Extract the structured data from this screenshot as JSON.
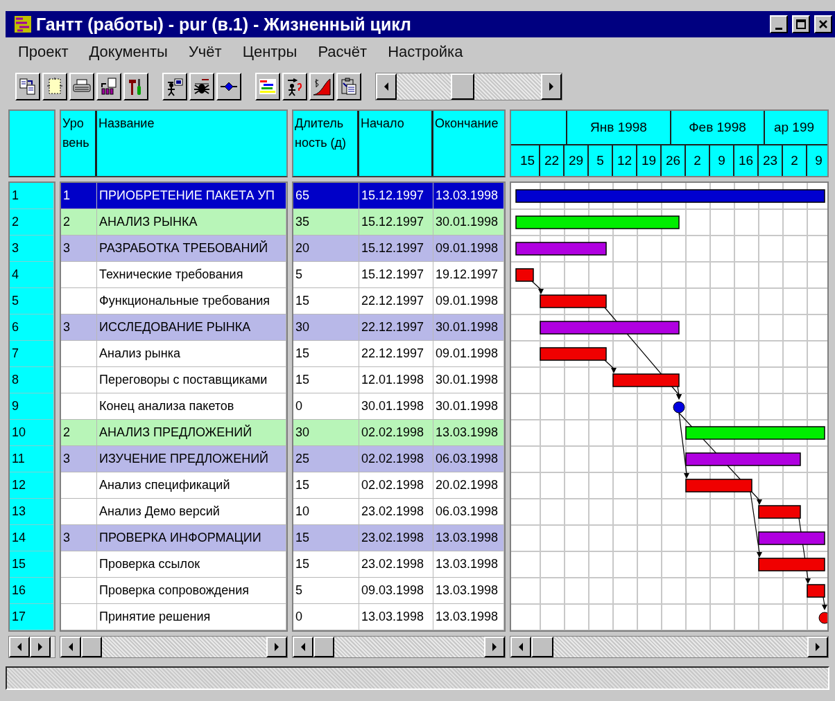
{
  "window": {
    "title": "Гантт (работы) - pur (в.1) - Жизненный цикл"
  },
  "menu": [
    "Проект",
    "Документы",
    "Учёт",
    "Центры",
    "Расчёт",
    "Настройка"
  ],
  "table": {
    "columns": [
      {
        "lines": [
          "Уро",
          "вень"
        ]
      },
      {
        "lines": [
          "Название"
        ]
      },
      {
        "lines": [
          "Длитель",
          "ность (д)"
        ]
      },
      {
        "lines": [
          "Начало"
        ]
      },
      {
        "lines": [
          "Окончание"
        ]
      }
    ],
    "rows": [
      {
        "num": "1",
        "level": "1",
        "name": "ПРИОБРЕТЕНИЕ ПАКЕТА УП",
        "duration": "65",
        "start": "15.12.1997",
        "end": "13.03.1998",
        "kind": "phase",
        "color": "#0000d0",
        "selected": true
      },
      {
        "num": "2",
        "level": "2",
        "name": "АНАЛИЗ РЫНКА",
        "duration": "35",
        "start": "15.12.1997",
        "end": "30.01.1998",
        "kind": "stage",
        "color": "#00ee00",
        "selected": false
      },
      {
        "num": "3",
        "level": "3",
        "name": "РАЗРАБОТКА ТРЕБОВАНИЙ",
        "duration": "20",
        "start": "15.12.1997",
        "end": "09.01.1998",
        "kind": "group",
        "color": "#b000e0",
        "selected": false
      },
      {
        "num": "4",
        "name": "Технические требования",
        "duration": "5",
        "start": "15.12.1997",
        "end": "19.12.1997",
        "kind": "task",
        "color": "#f00000",
        "selected": false
      },
      {
        "num": "5",
        "name": "Функциональные требования",
        "duration": "15",
        "start": "22.12.1997",
        "end": "09.01.1998",
        "kind": "task",
        "color": "#f00000",
        "selected": false
      },
      {
        "num": "6",
        "level": "3",
        "name": "ИССЛЕДОВАНИЕ РЫНКА",
        "duration": "30",
        "start": "22.12.1997",
        "end": "30.01.1998",
        "kind": "group",
        "color": "#b000e0",
        "selected": false
      },
      {
        "num": "7",
        "name": "Анализ рынка",
        "duration": "15",
        "start": "22.12.1997",
        "end": "09.01.1998",
        "kind": "task",
        "color": "#f00000",
        "selected": false
      },
      {
        "num": "8",
        "name": "Переговоры с поставщиками",
        "duration": "15",
        "start": "12.01.1998",
        "end": "30.01.1998",
        "kind": "task",
        "color": "#f00000",
        "selected": false
      },
      {
        "num": "9",
        "name": "Конец анализа пакетов",
        "duration": "0",
        "start": "30.01.1998",
        "end": "30.01.1998",
        "kind": "milestone",
        "color": "#0000e0",
        "selected": false
      },
      {
        "num": "10",
        "level": "2",
        "name": "АНАЛИЗ ПРЕДЛОЖЕНИЙ",
        "duration": "30",
        "start": "02.02.1998",
        "end": "13.03.1998",
        "kind": "stage",
        "color": "#00ee00",
        "selected": false
      },
      {
        "num": "11",
        "level": "3",
        "name": "ИЗУЧЕНИЕ ПРЕДЛОЖЕНИЙ",
        "duration": "25",
        "start": "02.02.1998",
        "end": "06.03.1998",
        "kind": "group",
        "color": "#b000e0",
        "selected": false
      },
      {
        "num": "12",
        "name": "Анализ спецификаций",
        "duration": "15",
        "start": "02.02.1998",
        "end": "20.02.1998",
        "kind": "task",
        "color": "#f00000",
        "selected": false
      },
      {
        "num": "13",
        "name": "Анализ Демо версий",
        "duration": "10",
        "start": "23.02.1998",
        "end": "06.03.1998",
        "kind": "task",
        "color": "#f00000",
        "selected": false
      },
      {
        "num": "14",
        "level": "3",
        "name": "ПРОВЕРКА ИНФОРМАЦИИ",
        "duration": "15",
        "start": "23.02.1998",
        "end": "13.03.1998",
        "kind": "group",
        "color": "#b000e0",
        "selected": false
      },
      {
        "num": "15",
        "name": "Проверка ссылок",
        "duration": "15",
        "start": "23.02.1998",
        "end": "13.03.1998",
        "kind": "task",
        "color": "#f00000",
        "selected": false
      },
      {
        "num": "16",
        "name": "Проверка сопровождения",
        "duration": "5",
        "start": "09.03.1998",
        "end": "13.03.1998",
        "kind": "task",
        "color": "#f00000",
        "selected": false
      },
      {
        "num": "17",
        "name": "Принятие решения",
        "duration": "0",
        "start": "13.03.1998",
        "end": "13.03.1998",
        "kind": "milestone",
        "color": "#f00000",
        "selected": false
      }
    ]
  },
  "timeline": {
    "months": [
      "Янв 1998",
      "Фев 1998",
      "ар 199"
    ],
    "weeks": [
      "15",
      "22",
      "29",
      "5",
      "12",
      "19",
      "26",
      "2",
      "9",
      "16",
      "23",
      "2",
      "9"
    ]
  }
}
